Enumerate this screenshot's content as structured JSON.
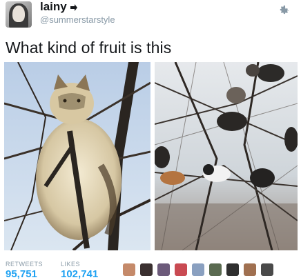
{
  "author": {
    "name": "lainy",
    "handle": "@summerstarstyle",
    "avatar_icon": "profile-avatar",
    "verified_icon": "arrow-badge-icon"
  },
  "tweet": {
    "text": "What kind of fruit is this"
  },
  "stats": {
    "retweets_label": "RETWEETS",
    "retweets_value": "95,751",
    "likes_label": "LIKES",
    "likes_value": "102,741"
  },
  "likers_count": 9,
  "colors": {
    "accent": "#1da1f2",
    "muted": "#8899a6",
    "text": "#14171a"
  }
}
